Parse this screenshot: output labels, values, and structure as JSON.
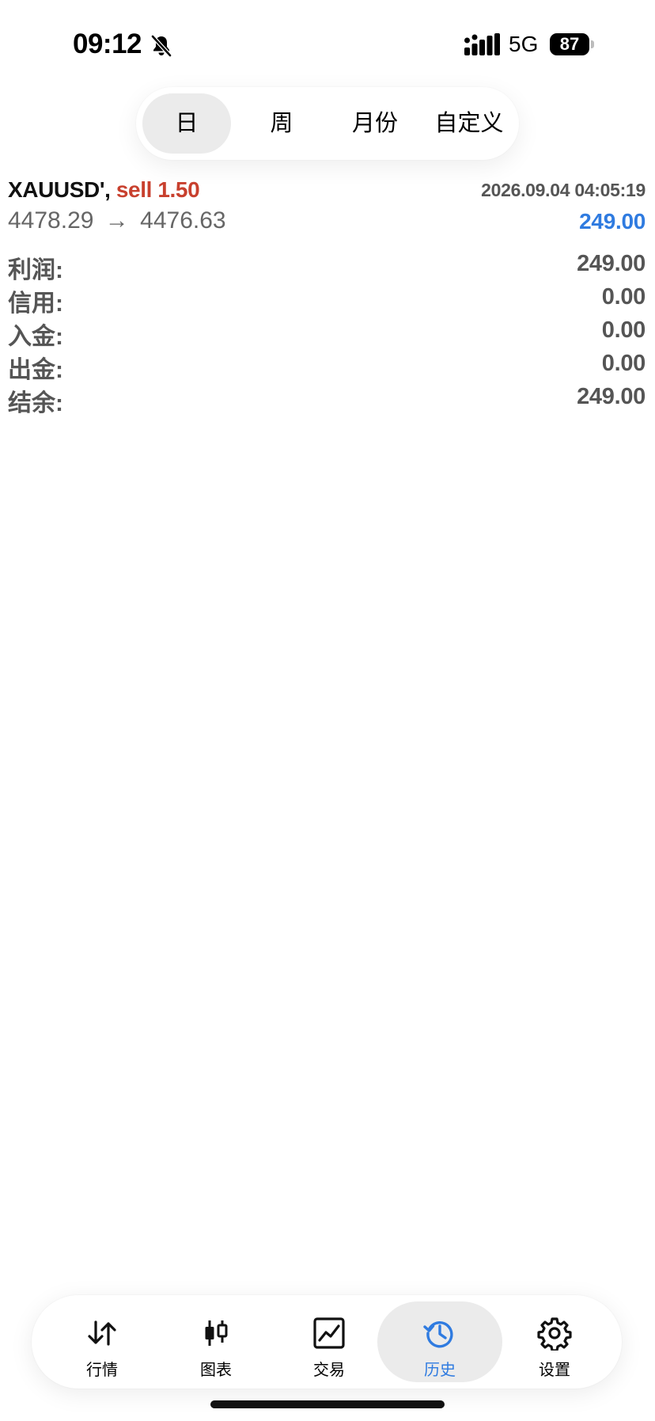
{
  "status": {
    "time": "09:12",
    "network": "5G",
    "battery": "87"
  },
  "segments": [
    {
      "label": "日",
      "active": true
    },
    {
      "label": "周",
      "active": false
    },
    {
      "label": "月份",
      "active": false
    },
    {
      "label": "自定义",
      "active": false
    }
  ],
  "trade": {
    "symbol": "XAUUSD',",
    "side": "sell 1.50",
    "datetime": "2026.09.04 04:05:19",
    "open_price": "4478.29",
    "arrow": "→",
    "close_price": "4476.63",
    "profit": "249.00"
  },
  "summary": [
    {
      "label": "利润:",
      "value": "249.00"
    },
    {
      "label": "信用:",
      "value": "0.00"
    },
    {
      "label": "入金:",
      "value": "0.00"
    },
    {
      "label": "出金:",
      "value": "0.00"
    },
    {
      "label": "结余:",
      "value": "249.00"
    }
  ],
  "tabs": [
    {
      "label": "行情",
      "icon": "quotes-arrows-icon"
    },
    {
      "label": "图表",
      "icon": "candlestick-chart-icon"
    },
    {
      "label": "交易",
      "icon": "trade-line-chart-icon"
    },
    {
      "label": "历史",
      "icon": "history-clock-icon",
      "active": true
    },
    {
      "label": "设置",
      "icon": "gear-icon"
    }
  ],
  "colors": {
    "accent": "#2f7be0",
    "sell": "#c8402e",
    "text_secondary": "#555555"
  }
}
